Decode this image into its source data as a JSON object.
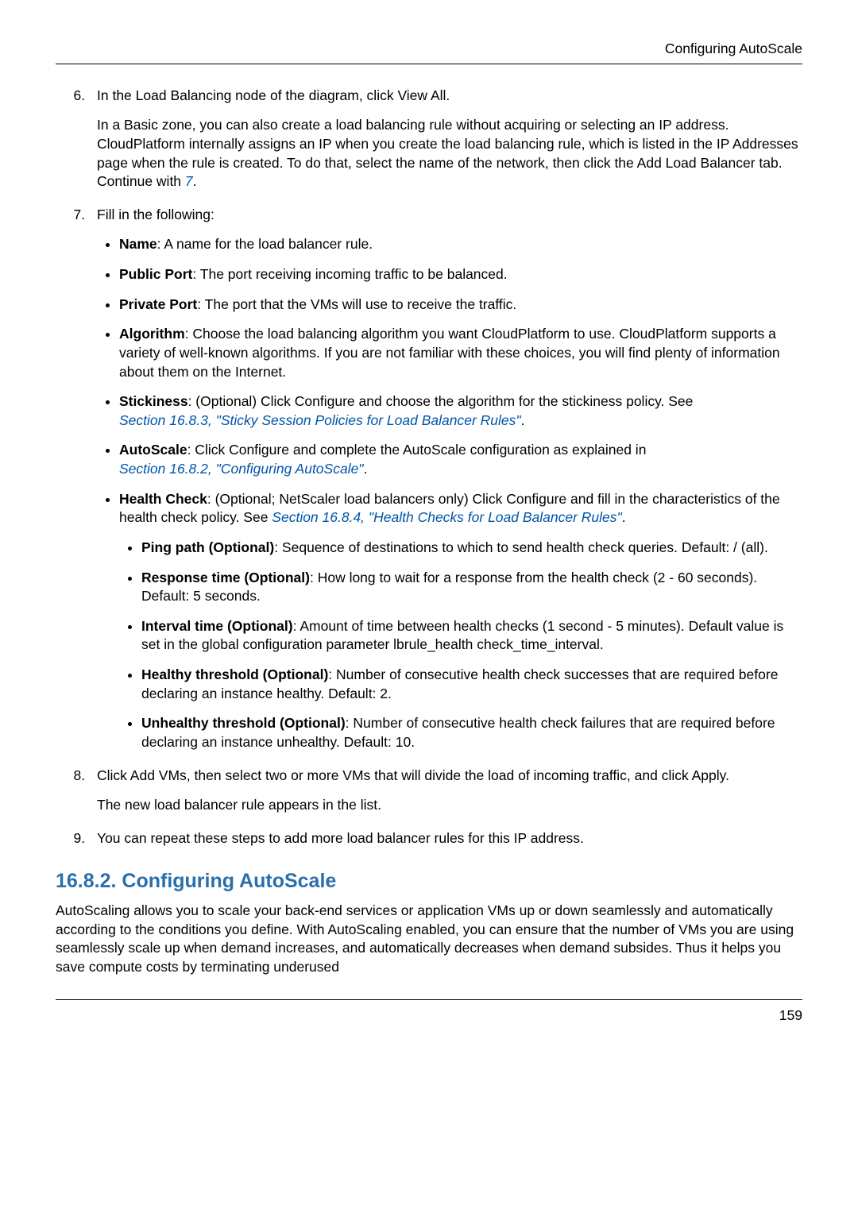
{
  "header": {
    "running": "Configuring AutoScale"
  },
  "footer": {
    "page": "159"
  },
  "steps": {
    "s6": {
      "lead": "In the Load Balancing node of the diagram, click View All.",
      "para": "In a Basic zone, you can also create a load balancing rule without acquiring or selecting an IP address. CloudPlatform internally assigns an IP when you create the load balancing rule, which is listed in the IP Addresses page when the rule is created. To do that, select the name of the network, then click the Add Load Balancer tab. Continue with ",
      "link7": "7",
      "period": "."
    },
    "s7": {
      "lead": "Fill in the following:",
      "name": {
        "label": "Name",
        "text": ": A name for the load balancer rule."
      },
      "pubport": {
        "label": "Public Port",
        "text": ": The port receiving incoming traffic to be balanced."
      },
      "privport": {
        "label": "Private Port",
        "text": ": The port that the VMs will use to receive the traffic."
      },
      "algo": {
        "label": "Algorithm",
        "text": ": Choose the load balancing algorithm you want CloudPlatform to use. CloudPlatform supports a variety of well-known algorithms. If you are not familiar with these choices, you will find plenty of information about them on the Internet."
      },
      "stick": {
        "label": "Stickiness",
        "text": ": (Optional) Click Configure and choose the algorithm for the stickiness policy. See ",
        "link": "Section 16.8.3, \"Sticky Session Policies for Load Balancer Rules\"",
        "tail": "."
      },
      "autoscale": {
        "label": "AutoScale",
        "text": ": Click Configure and complete the AutoScale configuration as explained in ",
        "link": "Section 16.8.2, \"Configuring AutoScale\"",
        "tail": "."
      },
      "health": {
        "label": "Health Check",
        "text": ": (Optional; NetScaler load balancers only) Click Configure and fill in the characteristics of the health check policy. See ",
        "link": "Section 16.8.4, \"Health Checks for Load Balancer Rules\"",
        "tail": ".",
        "ping": {
          "label": "Ping path (Optional)",
          "text": ": Sequence of destinations to which to send health check queries. Default: / (all)."
        },
        "resp": {
          "label": "Response time (Optional)",
          "text": ": How long to wait for a response from the health check (2 - 60 seconds). Default: 5 seconds."
        },
        "interval": {
          "label": "Interval time (Optional)",
          "text": ": Amount of time between health checks (1 second - 5 minutes). Default value is set in the global configuration parameter lbrule_health check_time_interval."
        },
        "healthy": {
          "label": "Healthy threshold (Optional)",
          "text": ": Number of consecutive health check successes that are required before declaring an instance healthy. Default: 2."
        },
        "unhealthy": {
          "label": "Unhealthy threshold (Optional)",
          "text": ": Number of consecutive health check failures that are required before declaring an instance unhealthy. Default: 10."
        }
      }
    },
    "s8": {
      "lead": "Click Add VMs, then select two or more VMs that will divide the load of incoming traffic, and click Apply.",
      "para": "The new load balancer rule appears in the list."
    },
    "s9": {
      "lead": "You can repeat these steps to add more load balancer rules for this IP address."
    }
  },
  "section": {
    "title": "16.8.2. Configuring AutoScale",
    "body": "AutoScaling allows you to scale your back-end services or application VMs up or down seamlessly and automatically according to the conditions you define. With AutoScaling enabled, you can ensure that the number of VMs you are using seamlessly scale up when demand increases, and automatically decreases when demand subsides. Thus it helps you save compute costs by terminating underused"
  }
}
